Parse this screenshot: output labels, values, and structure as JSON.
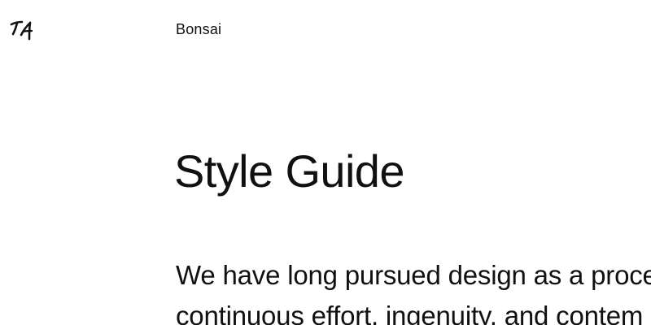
{
  "header": {
    "logo_icon": "ta-signature-logo-icon",
    "logo_text": "TA",
    "brand_label": "Bonsai"
  },
  "main": {
    "title": "Style Guide",
    "intro_lines": [
      "We have long pursued design as a proce",
      "continuous effort, ingenuity, and contem"
    ]
  },
  "colors": {
    "background": "#ffffff",
    "text": "#111111"
  }
}
